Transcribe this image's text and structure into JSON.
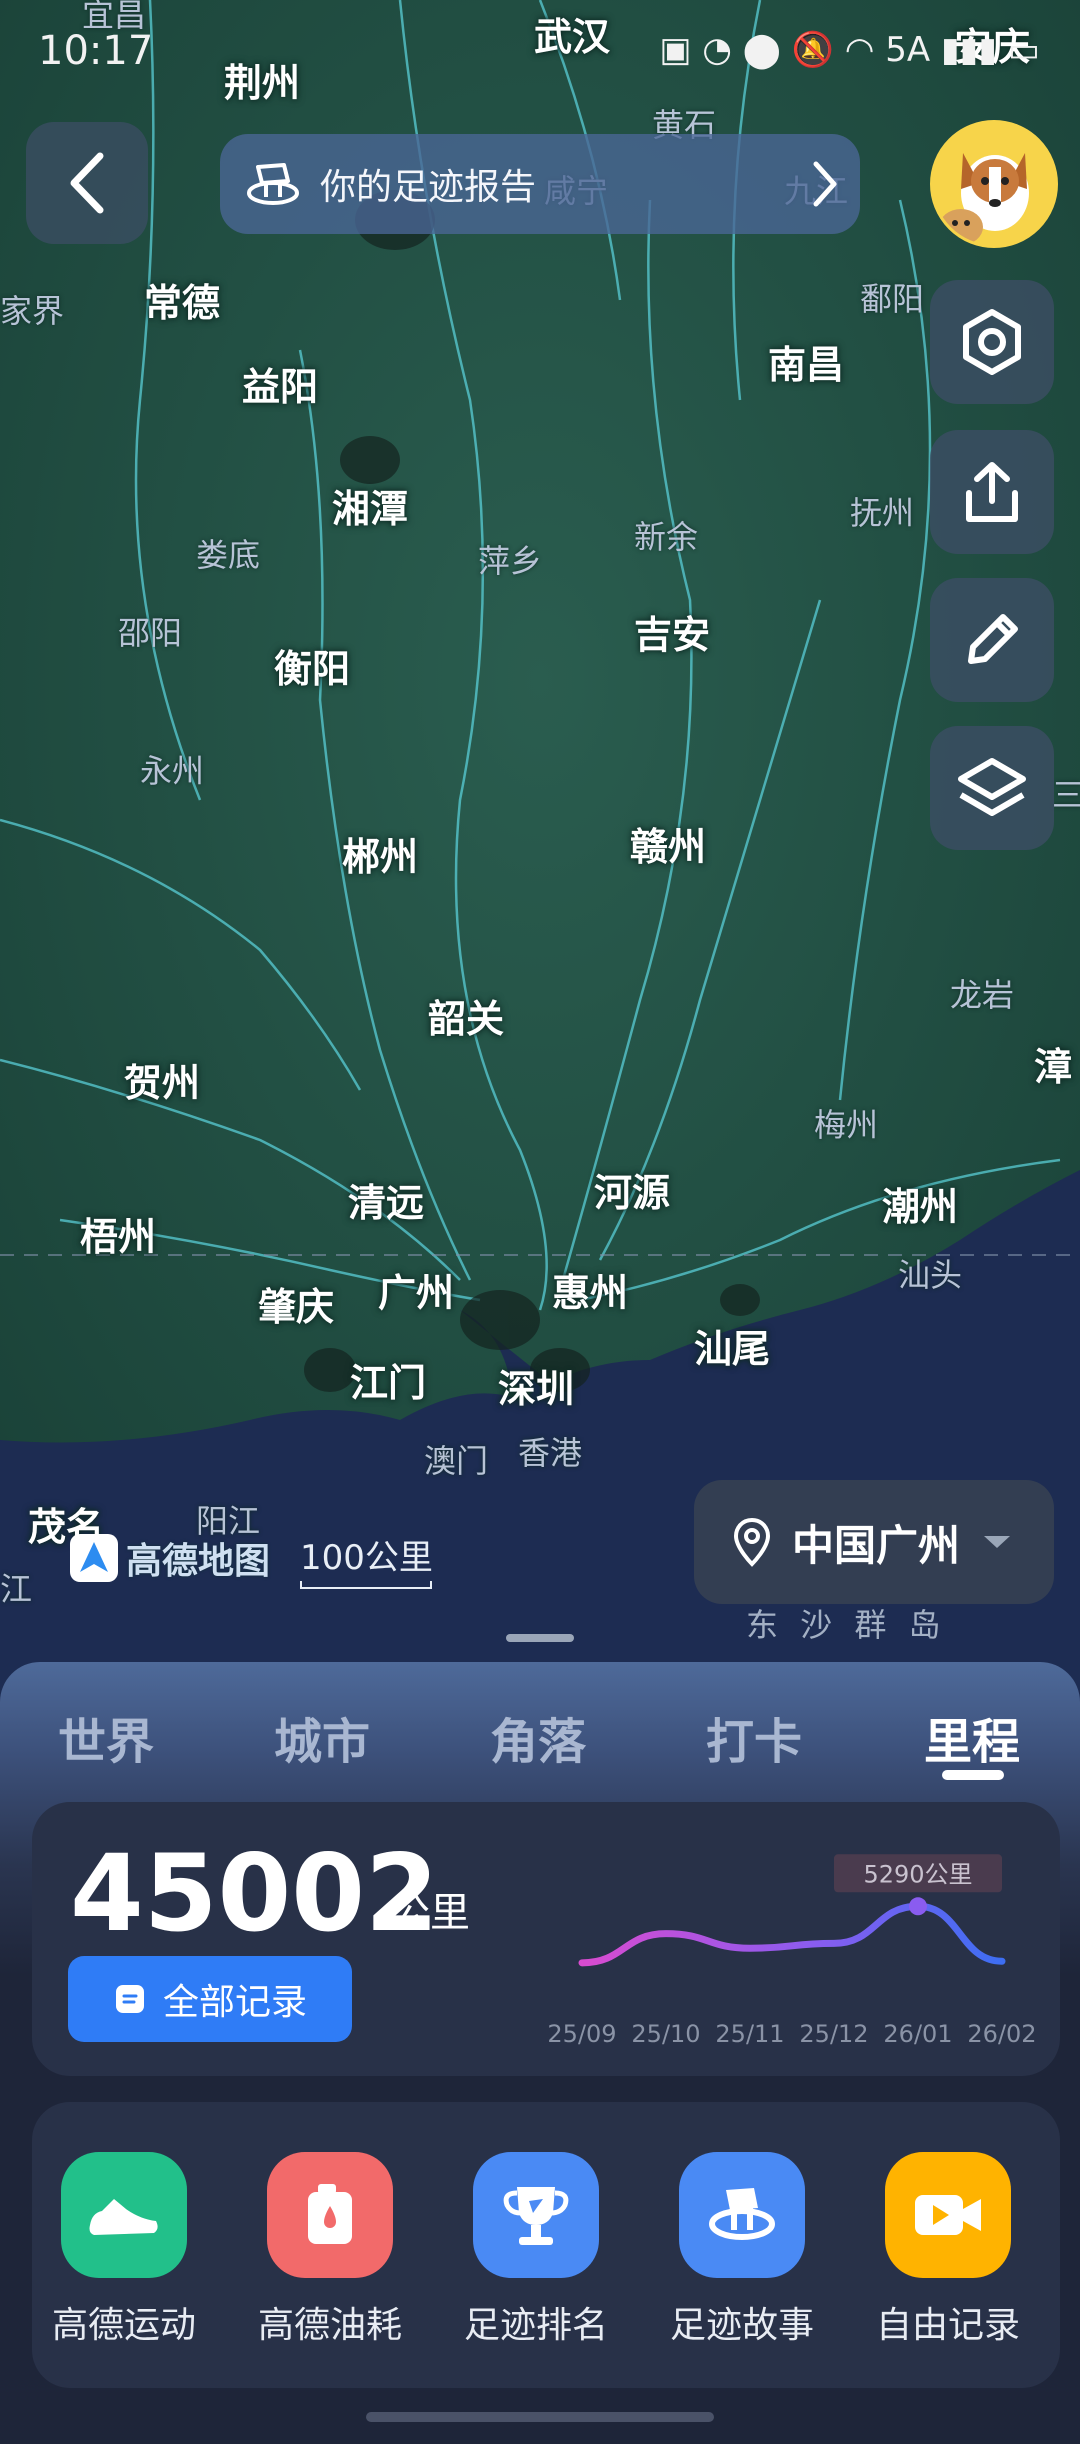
{
  "status_bar": {
    "time": "10:17",
    "icons": "▣ ◔ ⬤ 🔕 ◠ 5A ▮▮▮ ▭"
  },
  "header": {
    "report_title": "你的足迹报告"
  },
  "map": {
    "cities_major": [
      "荆州",
      "武汉",
      "安庆",
      "常德",
      "益阳",
      "南昌",
      "湘潭",
      "吉安",
      "衡阳",
      "赣州",
      "郴州",
      "韶关",
      "贺州",
      "漳",
      "梧州",
      "清远",
      "河源",
      "潮州",
      "肇庆",
      "广州",
      "惠州",
      "汕尾",
      "江门",
      "深圳",
      "茂名"
    ],
    "cities_minor": [
      "宜昌",
      "黄石",
      "咸宁",
      "九江",
      "家界",
      "鄱阳",
      "抚州",
      "娄底",
      "萍乡",
      "新余",
      "邵阳",
      "永州",
      "龙岩",
      "梅州",
      "汕头",
      "澳门",
      "香港",
      "阳江",
      "江",
      "三"
    ],
    "sea_label": "东 沙 群 岛",
    "brand": "高德地图",
    "scale_label": "100公里",
    "location": "中国广州"
  },
  "tabs": [
    {
      "label": "世界"
    },
    {
      "label": "城市"
    },
    {
      "label": "角落"
    },
    {
      "label": "打卡"
    },
    {
      "label": "里程"
    }
  ],
  "active_tab": "里程",
  "mileage": {
    "total": "45002",
    "unit": "公里",
    "all_records_label": "全部记录"
  },
  "chart_data": {
    "type": "line",
    "categories": [
      "25/09",
      "25/10",
      "25/11",
      "25/12",
      "26/01",
      "26/02"
    ],
    "values": [
      1800,
      3600,
      2700,
      3000,
      5290,
      1900
    ],
    "highlight_label": "5290公里",
    "highlight_index": 4,
    "grid": false
  },
  "apps": [
    {
      "label": "高德运动",
      "icon": "sneaker-icon",
      "color": "#22c08a"
    },
    {
      "label": "高德油耗",
      "icon": "fuel-can-icon",
      "color": "#f26a6a"
    },
    {
      "label": "足迹排名",
      "icon": "trophy-icon",
      "color": "#4a8af4"
    },
    {
      "label": "足迹故事",
      "icon": "footprint-story-icon",
      "color": "#4a8af4"
    },
    {
      "label": "自由记录",
      "icon": "video-camera-icon",
      "color": "#ffb300"
    }
  ]
}
